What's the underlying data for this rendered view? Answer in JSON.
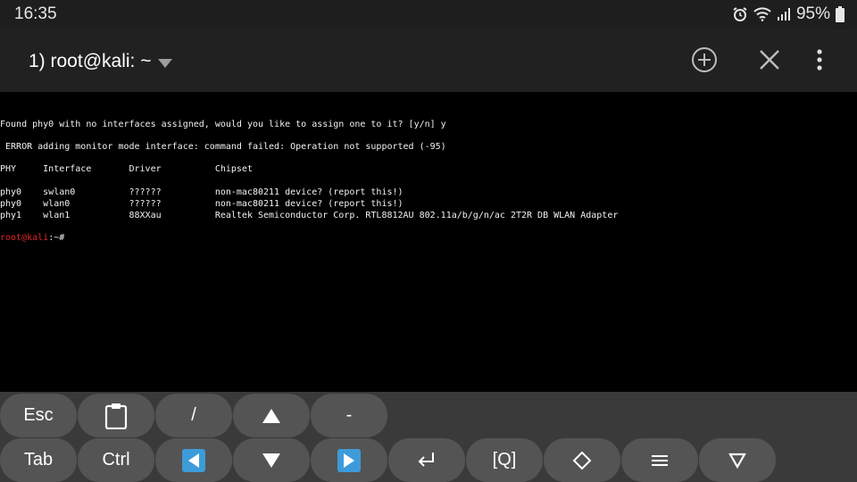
{
  "status_bar": {
    "time": "16:35",
    "battery": "95%",
    "icons": [
      "alarm-icon",
      "wifi-icon",
      "signal-icon",
      "battery-icon"
    ]
  },
  "app_bar": {
    "title": "1) root@kali: ~",
    "actions": [
      "add-session-icon",
      "close-icon",
      "more-options-icon"
    ]
  },
  "terminal": {
    "lines": [
      "Found phy0 with no interfaces assigned, would you like to assign one to it? [y/n] y",
      " ERROR adding monitor mode interface: command failed: Operation not supported (-95)",
      "PHY     Interface       Driver          Chipset",
      "phy0    swlan0          ??????          non-mac80211 device? (report this!)",
      "phy0    wlan0           ??????          non-mac80211 device? (report this!)",
      "phy1    wlan1           88XXau          Realtek Semiconductor Corp. RTL8812AU 802.11a/b/g/n/ac 2T2R DB WLAN Adapter"
    ],
    "prompt_user": "root@kali",
    "prompt_rest": ":~#"
  },
  "extra_keys": {
    "row1": [
      "Esc",
      "clipboard-icon",
      "/",
      "arrow-up-icon",
      "-"
    ],
    "row2": [
      "Tab",
      "Ctrl",
      "arrow-left-icon",
      "arrow-down-icon",
      "arrow-right-icon",
      "enter-icon",
      "[Q]",
      "diamond-icon",
      "menu-icon",
      "triangle-down-icon"
    ],
    "labels": {
      "esc": "Esc",
      "slash": "/",
      "dash": "-",
      "tab": "Tab",
      "ctrl": "Ctrl",
      "q": "[Q]"
    }
  },
  "colors": {
    "terminal_bg": "#000000",
    "terminal_fg": "#f2f2f2",
    "prompt_user": "#e0262a",
    "key_bg": "#545454",
    "keys_panel_bg": "#3a3a3a",
    "arrow_blue": "#3d9bd9"
  }
}
